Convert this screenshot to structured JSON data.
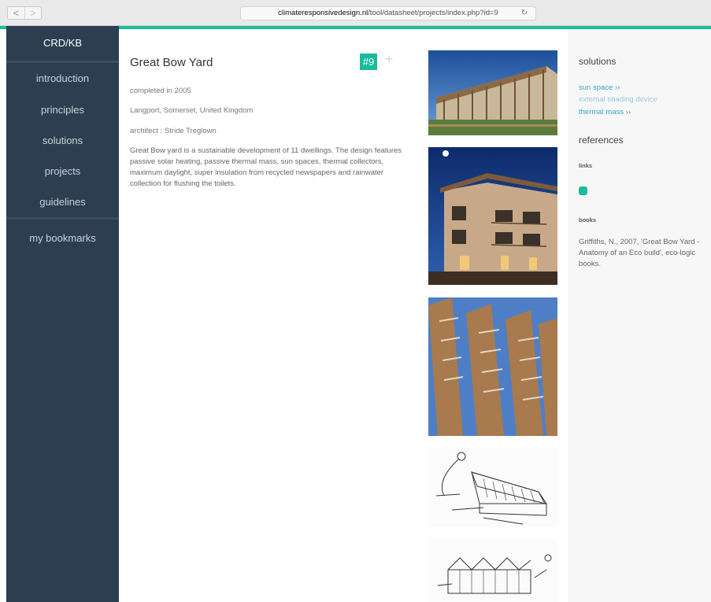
{
  "browser": {
    "url_domain": "climateresponsivedesign.nl",
    "url_path": "/tool/datasheet/projects/index.php?id=9",
    "back_glyph": "<",
    "forward_glyph": ">",
    "reload_glyph": "↻"
  },
  "sidebar": {
    "brand": "CRD/KB",
    "items": [
      {
        "label": "introduction"
      },
      {
        "label": "principles"
      },
      {
        "label": "solutions"
      },
      {
        "label": "projects"
      },
      {
        "label": "guidelines"
      },
      {
        "label": "my bookmarks"
      }
    ]
  },
  "project": {
    "title": "Great Bow Yard",
    "number": "#9",
    "add_glyph": "+",
    "completed": "completed in 2005",
    "location": "Langport, Somerset, United Kingdom",
    "architect": "architect : Stride Treglown",
    "description": "Great Bow yard is a sustainable development of 11 dwellings. The design features passive solar heating, passive thermal mass, sun spaces, thermal collectors, maximum daylight, super insulation from recycled newspapers and rainwater collection for flushing the toilets."
  },
  "right_panel": {
    "solutions_heading": "solutions",
    "solutions": [
      {
        "label": "sun space ››",
        "active": true
      },
      {
        "label": "external shading device",
        "active": false
      },
      {
        "label": "thermal mass ››",
        "active": true
      }
    ],
    "references_heading": "references",
    "links_label": "links",
    "books_label": "books",
    "book_text": "Griffiths, N., 2007, 'Great Bow Yard - Anatomy of an Eco build', eco-logic books."
  },
  "colors": {
    "accent": "#1abc9c",
    "sidebar_bg": "#2c3e50",
    "link": "#3aa3c8"
  }
}
